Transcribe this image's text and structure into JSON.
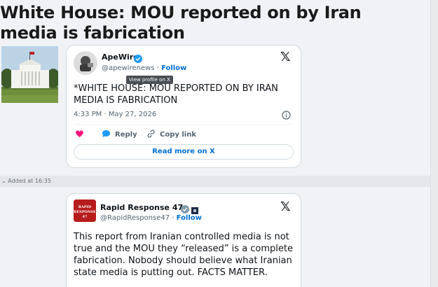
{
  "article": {
    "headline": "White House: MOU reported on by Iran media is fabrication"
  },
  "tweet1": {
    "author_name": "ApeWire",
    "handle": "@apewirenews",
    "separator": "·",
    "follow_label": "Follow",
    "tooltip": "View profile on X",
    "text": "*WHITE HOUSE: MOU REPORTED ON BY IRAN MEDIA IS FABRICATION",
    "timestamp": "4:33 PM · May 27, 2026",
    "reply_label": "Reply",
    "copy_link_label": "Copy link",
    "read_more_label": "Read more on X"
  },
  "separator": {
    "added_text": "Added at 16:35"
  },
  "tweet2": {
    "author_name": "Rapid Response 47",
    "handle": "@RapidResponse47",
    "separator": "·",
    "follow_label": "Follow",
    "avatar_text": "RAPID RESPONSE 47",
    "text": "This report from Iranian controlled media is not true and the MOU they “released” is a complete fabrication. Nobody should believe what Iranian state media is putting out. FACTS MATTER."
  },
  "colors": {
    "link_blue": "#006fd6",
    "verified_blue": "#1d9bf0",
    "like_pink": "#f91880",
    "gov_gray": "#829aab"
  }
}
